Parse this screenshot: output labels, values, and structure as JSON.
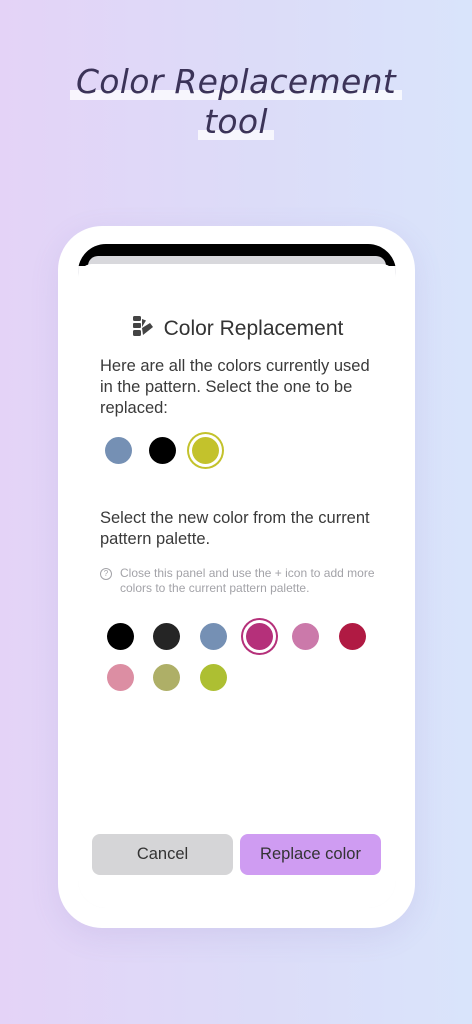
{
  "headline": {
    "line1": "Color Replacement",
    "line2": "tool"
  },
  "panel": {
    "title": "Color Replacement",
    "title_icon": "palette-swatch-icon",
    "intro_text": "Here are all the colors currently used in the pattern. Select the one to be replaced:",
    "current_colors": [
      {
        "hex": "#7590b4",
        "selected": false
      },
      {
        "hex": "#000000",
        "selected": false
      },
      {
        "hex": "#c3c22c",
        "selected": true
      }
    ],
    "new_color_text": "Select the new color from the current pattern palette.",
    "hint_icon": "question-circle-icon",
    "hint_text": "Close this panel and use the + icon to add more colors to the current pattern palette.",
    "palette_colors": [
      {
        "hex": "#000000",
        "selected": false
      },
      {
        "hex": "#252525",
        "selected": false
      },
      {
        "hex": "#7590b4",
        "selected": false
      },
      {
        "hex": "#b5307a",
        "selected": true
      },
      {
        "hex": "#cb79aa",
        "selected": false
      },
      {
        "hex": "#b01a43",
        "selected": false
      },
      {
        "hex": "#dc8ea3",
        "selected": false
      },
      {
        "hex": "#aeaf67",
        "selected": false
      },
      {
        "hex": "#adbf32",
        "selected": false
      }
    ],
    "cancel_label": "Cancel",
    "replace_label": "Replace color"
  },
  "colors": {
    "accent": "#cf9cf2",
    "cancel_bg": "#d5d5d7"
  }
}
